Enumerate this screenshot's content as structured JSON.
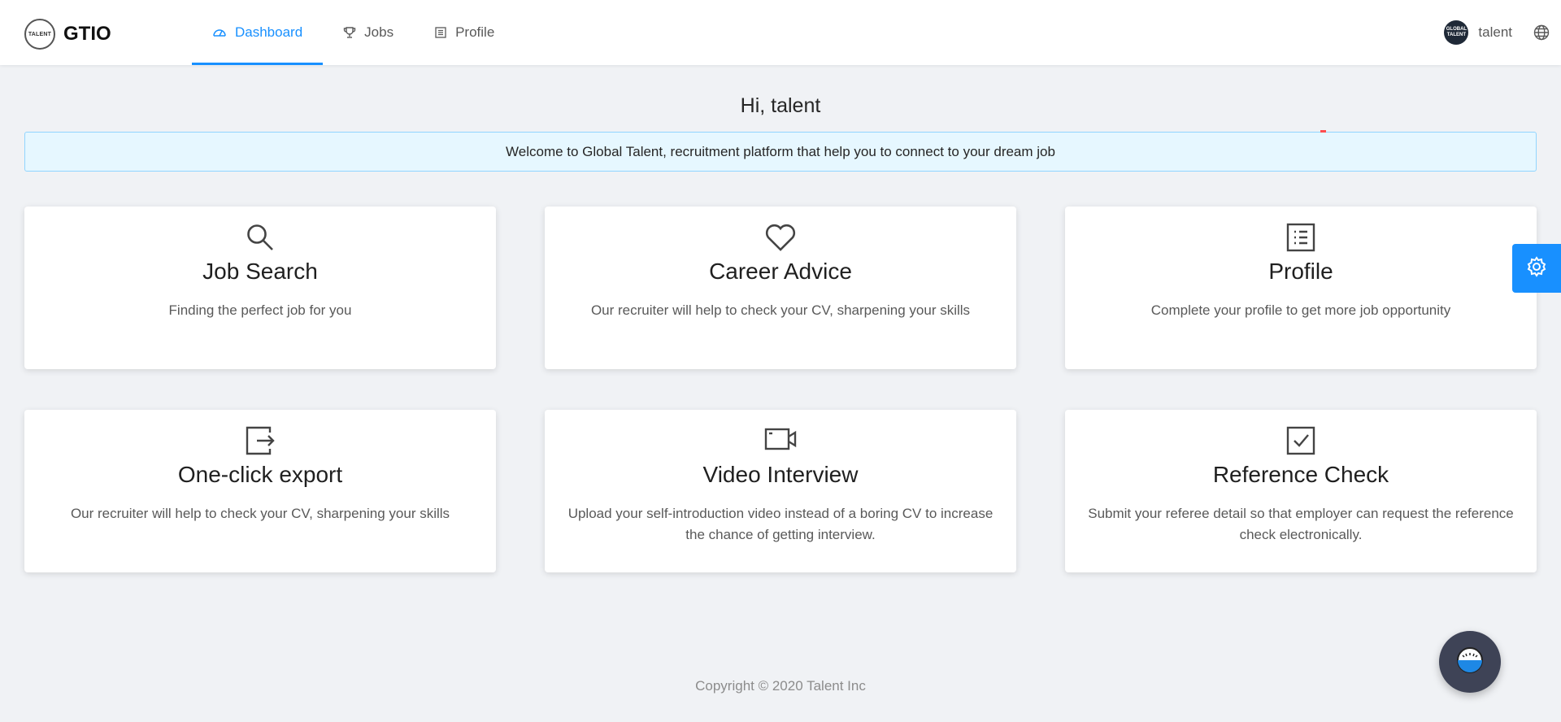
{
  "brand": {
    "name": "GTIO",
    "logo_text": "TALENT",
    "logo_icon": "talent-logo"
  },
  "nav": {
    "items": [
      {
        "label": "Dashboard",
        "icon": "dashboard-icon",
        "active": true
      },
      {
        "label": "Jobs",
        "icon": "trophy-icon",
        "active": false
      },
      {
        "label": "Profile",
        "icon": "profile-icon",
        "active": false
      }
    ]
  },
  "user": {
    "name": "talent",
    "avatar_text": "GLOBAL TALENT",
    "language_icon": "globe-icon"
  },
  "greeting": "Hi, talent",
  "banner": "Welcome to Global Talent, recruitment platform that help you to connect to your dream job",
  "cards": [
    {
      "title": "Job Search",
      "desc": "Finding the perfect job for you",
      "icon": "search-icon"
    },
    {
      "title": "Career Advice",
      "desc": "Our recruiter will help to check your CV, sharpening your skills",
      "icon": "heart-icon"
    },
    {
      "title": "Profile",
      "desc": "Complete your profile to get more job opportunity",
      "icon": "profile-list-icon"
    },
    {
      "title": "One-click export",
      "desc": "Our recruiter will help to check your CV, sharpening your skills",
      "icon": "export-icon"
    },
    {
      "title": "Video Interview",
      "desc": "Upload your self-introduction video instead of a boring CV to increase the chance of getting interview.",
      "icon": "video-camera-icon"
    },
    {
      "title": "Reference Check",
      "desc": "Submit your referee detail so that employer can request the reference check electronically.",
      "icon": "checkbox-icon"
    }
  ],
  "footer": "Copyright © 2020 Talent Inc",
  "colors": {
    "primary": "#1890ff",
    "background": "#f0f2f5",
    "banner_bg": "#e6f7ff",
    "chat_bg": "#3e4356"
  }
}
